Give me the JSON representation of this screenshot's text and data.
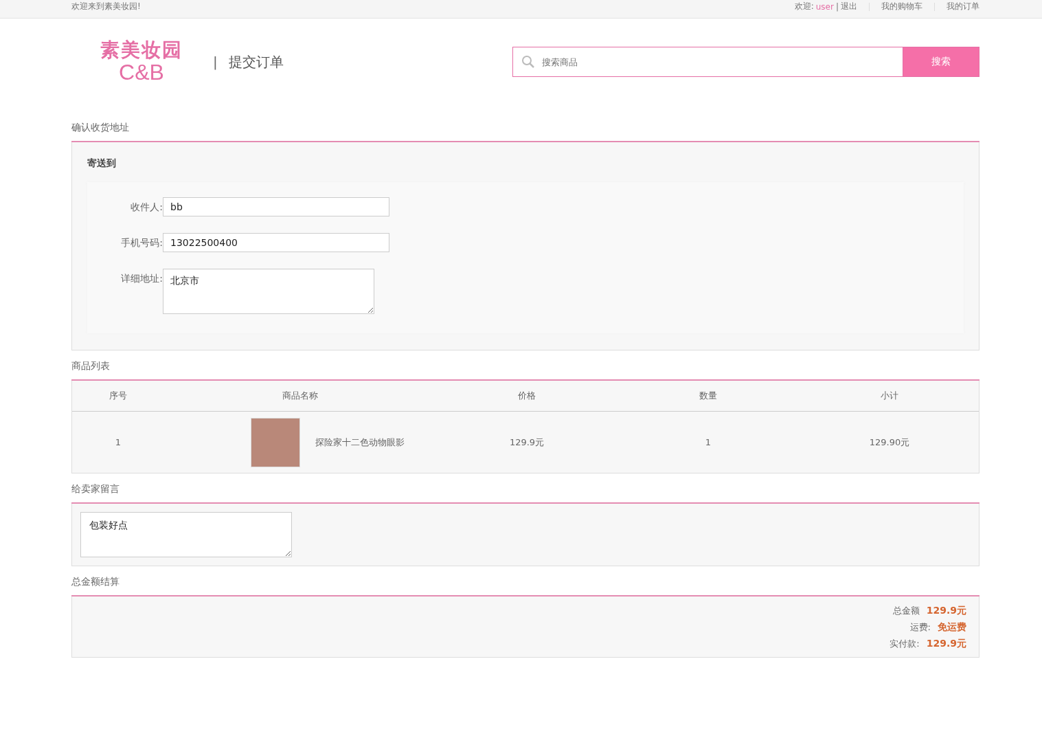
{
  "top_bar": {
    "welcome": "欢迎来到素美妆园!",
    "greeting": "欢迎:",
    "username": "user",
    "separator": "|",
    "logout": "退出",
    "links": [
      "我的购物车",
      "我的订单"
    ]
  },
  "header": {
    "logo_line1": "素美妆园",
    "logo_line2": "C&B",
    "divider": "|",
    "page_title": "提交订单",
    "search": {
      "placeholder": "搜索商品",
      "button": "搜索"
    }
  },
  "address": {
    "title": "确认收货地址",
    "subtitle": "寄送到",
    "fields": [
      {
        "label": "收件人:",
        "value": "bb",
        "kind": "input"
      },
      {
        "label": "手机号码:",
        "value": "13022500400",
        "kind": "input"
      },
      {
        "label": "详细地址:",
        "value": "北京市",
        "kind": "textarea"
      }
    ]
  },
  "products": {
    "title": "商品列表",
    "columns": [
      "序号",
      "商品名称",
      "价格",
      "数量",
      "小计"
    ],
    "rows": [
      {
        "index": "1",
        "name": "探险家十二色动物眼影",
        "price": "129.9元",
        "quantity": "1",
        "subtotal": "129.90元"
      }
    ]
  },
  "message": {
    "title": "给卖家留言",
    "value": "包装好点"
  },
  "summary": {
    "title": "总金额结算",
    "lines": [
      {
        "label": "总金额",
        "value": "129.9元"
      },
      {
        "label": "运费:",
        "value": "免运费"
      },
      {
        "label": "实付款:",
        "value": "129.9元"
      }
    ]
  }
}
